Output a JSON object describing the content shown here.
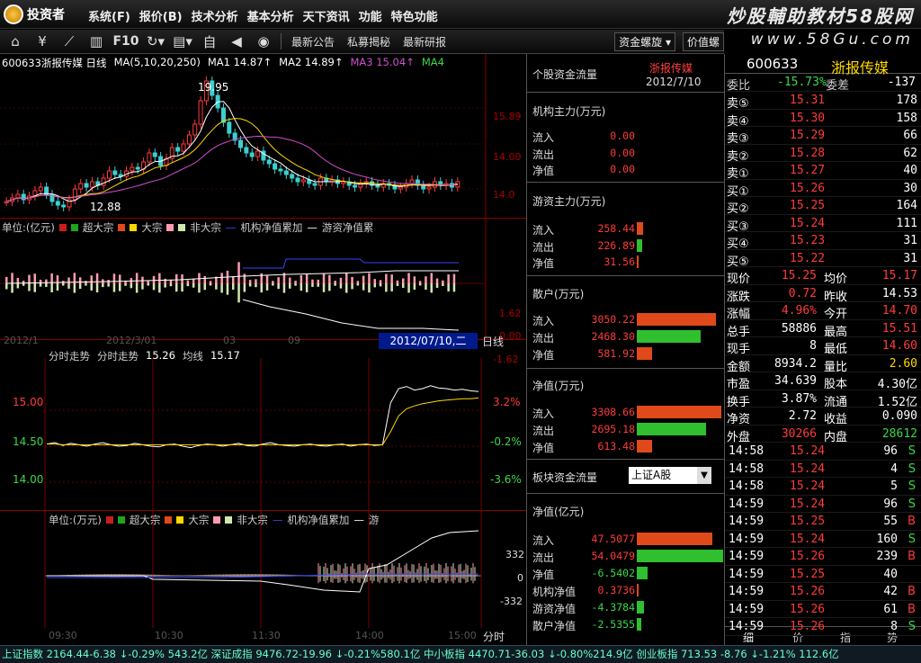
{
  "app": {
    "name": "投资者",
    "menus": [
      "系统(F)",
      "报价(B)",
      "技术分析",
      "基本分析",
      "天下资讯",
      "功能",
      "特色功能"
    ]
  },
  "watermark": {
    "line1": "炒股輔助教材58股网",
    "line2": "www.58Gu.com"
  },
  "toolbar": {
    "f10": "F10",
    "links": [
      "最新公告",
      "私募揭秘",
      "最新研报"
    ],
    "select1": "资金螺旋",
    "select2": "价值螺"
  },
  "kline": {
    "title": "600633浙报传媒  日线",
    "ma_params": "MA(5,10,20,250)",
    "ma1": "MA1 14.87↑",
    "ma2": "MA2 14.89↑",
    "ma3": "MA3 15.04↑",
    "ma4": "MA4",
    "high": "19.95",
    "low": "12.88",
    "yticks": [
      "15.89",
      "14.00",
      "14.0"
    ],
    "closes": [
      13.2,
      13.4,
      13.6,
      13.3,
      13.5,
      13.8,
      14.0,
      13.6,
      13.2,
      13.0,
      12.9,
      13.3,
      13.9,
      14.2,
      14.0,
      14.3,
      14.1,
      14.5,
      14.9,
      14.7,
      14.6,
      14.9,
      15.1,
      15.0,
      15.4,
      15.9,
      15.7,
      15.2,
      15.6,
      16.2,
      16.0,
      16.4,
      16.9,
      17.5,
      18.8,
      19.9,
      19.1,
      18.4,
      17.6,
      17.0,
      16.6,
      16.2,
      15.9,
      15.7,
      16.0,
      15.5,
      15.3,
      15.0,
      14.9,
      14.7,
      14.5,
      14.3,
      14.4,
      14.2,
      14.1,
      14.5,
      14.3,
      14.4,
      14.2,
      14.3,
      14.1,
      14.0,
      14.2,
      14.3,
      14.1,
      14.0,
      14.2,
      14.1,
      13.9,
      14.0,
      14.2,
      14.4,
      14.1,
      13.9,
      14.0,
      14.3,
      14.1,
      14.2,
      14.0,
      14.3
    ],
    "yrange": [
      12.5,
      20.5
    ]
  },
  "fund_legend": {
    "unit": "单位:(亿元)",
    "items": [
      "超大宗",
      "大宗",
      "非大宗"
    ],
    "line1": "机构净值累加",
    "line2": "游资净值累"
  },
  "fund_colors": [
    "#c81e1e",
    "#1ea51e",
    "#e04a1a",
    "#ffd600",
    "#ff9bb0",
    "#cfe8b0"
  ],
  "fund_y": [
    "1.62",
    "0.00",
    "-1.62"
  ],
  "dates": {
    "labels": [
      "2012/1",
      "2012/3/01",
      "06",
      "03",
      "09",
      "9"
    ],
    "badge": "2012/07/10,二",
    "period": "日线"
  },
  "fenshi": {
    "title": "分时走势",
    "title2": "分时走势",
    "price": "15.26",
    "avg_label": "均线",
    "avg": "15.17",
    "yleft": [
      "15.00",
      "14.50",
      "14.00"
    ],
    "yright": [
      "3.2%",
      "-0.2%",
      "-3.6%"
    ],
    "times": [
      "09:30",
      "10:30",
      "11:30",
      "14:00",
      "15:00"
    ],
    "axis_end": "分时",
    "prices": [
      14.53,
      14.55,
      14.51,
      14.54,
      14.52,
      14.5,
      14.53,
      14.55,
      14.52,
      14.5,
      14.51,
      14.54,
      14.52,
      14.5,
      14.49,
      14.52,
      14.53,
      14.5,
      14.48,
      14.51,
      14.53,
      14.52,
      14.5,
      14.52,
      14.54,
      14.51,
      14.5,
      14.53,
      14.55,
      14.52,
      14.51,
      14.5,
      14.52,
      14.53,
      14.51,
      14.5,
      14.52,
      14.53,
      14.5,
      14.52,
      14.53,
      14.51,
      14.52,
      15.1,
      15.3,
      15.33,
      15.28,
      15.3,
      15.34,
      15.31,
      15.3,
      15.28,
      15.29,
      15.27,
      15.26
    ],
    "avgs": [
      14.53,
      14.53,
      14.52,
      14.52,
      14.52,
      14.52,
      14.52,
      14.52,
      14.52,
      14.52,
      14.52,
      14.52,
      14.52,
      14.52,
      14.52,
      14.52,
      14.52,
      14.52,
      14.52,
      14.52,
      14.52,
      14.52,
      14.52,
      14.52,
      14.52,
      14.52,
      14.52,
      14.52,
      14.52,
      14.52,
      14.52,
      14.52,
      14.52,
      14.52,
      14.52,
      14.52,
      14.52,
      14.52,
      14.52,
      14.52,
      14.52,
      14.52,
      14.52,
      14.7,
      14.92,
      15.02,
      15.06,
      15.09,
      15.11,
      15.13,
      15.14,
      15.15,
      15.16,
      15.16,
      15.17
    ]
  },
  "fs2": {
    "unit": "单位:(万元)",
    "items": [
      "超大宗",
      "大宗",
      "非大宗"
    ],
    "line1": "机构净值累加",
    "line2": "游",
    "y": [
      "332",
      "0",
      "-332"
    ]
  },
  "mid": {
    "title": "个股资金流量",
    "stock": "浙报传媒",
    "date": "2012/7/10",
    "sections": [
      {
        "title": "机构主力(万元)",
        "rows": [
          [
            "流入",
            "0.00"
          ],
          [
            "流出",
            "0.00"
          ],
          [
            "净值",
            "0.00"
          ]
        ]
      },
      {
        "title": "游资主力(万元)",
        "rows": [
          [
            "流入",
            "258.44"
          ],
          [
            "流出",
            "226.89"
          ],
          [
            "净值",
            "31.56"
          ]
        ]
      },
      {
        "title": "散户(万元)",
        "rows": [
          [
            "流入",
            "3050.22"
          ],
          [
            "流出",
            "2468.30"
          ],
          [
            "净值",
            "581.92"
          ]
        ]
      },
      {
        "title": "净值(万元)",
        "rows": [
          [
            "流入",
            "3308.66"
          ],
          [
            "流出",
            "2695.18"
          ],
          [
            "净值",
            "613.48"
          ]
        ]
      }
    ],
    "block_title": "板块资金流量",
    "block_select": "上证A股",
    "net_title": "净值(亿元)",
    "net_rows": [
      [
        "流入",
        "47.5077"
      ],
      [
        "流出",
        "54.0479"
      ],
      [
        "净值",
        "-6.5402"
      ],
      [
        "机构净值",
        "0.3736"
      ],
      [
        "游资净值",
        "-4.3784"
      ],
      [
        "散户净值",
        "-2.5355"
      ]
    ]
  },
  "right": {
    "code": "600633",
    "name": "浙报传媒",
    "weibi_label": "委比",
    "weibi": "-15.73%",
    "weicha_label": "委差",
    "weicha": "-137",
    "sells": [
      [
        "卖⑤",
        "15.31",
        "178"
      ],
      [
        "卖④",
        "15.30",
        "158"
      ],
      [
        "卖③",
        "15.29",
        "66"
      ],
      [
        "卖②",
        "15.28",
        "62"
      ],
      [
        "卖①",
        "15.27",
        "40"
      ]
    ],
    "buys": [
      [
        "买①",
        "15.26",
        "30"
      ],
      [
        "买②",
        "15.25",
        "164"
      ],
      [
        "买③",
        "15.24",
        "111"
      ],
      [
        "买④",
        "15.23",
        "31"
      ],
      [
        "买⑤",
        "15.22",
        "31"
      ]
    ],
    "stats": [
      [
        "现价",
        "15.25",
        "均价",
        "15.17"
      ],
      [
        "涨跌",
        "0.72",
        "昨收",
        "14.53"
      ],
      [
        "涨幅",
        "4.96%",
        "今开",
        "14.70"
      ],
      [
        "总手",
        "58886",
        "最高",
        "15.51"
      ],
      [
        "现手",
        "8",
        "最低",
        "14.60"
      ],
      [
        "金额",
        "8934.2",
        "量比",
        "2.60"
      ],
      [
        "市盈",
        "34.639",
        "股本",
        "4.30亿"
      ],
      [
        "换手",
        "3.87%",
        "流通",
        "1.52亿"
      ],
      [
        "净资",
        "2.72",
        "收益",
        "0.090"
      ],
      [
        "外盘",
        "30266",
        "内盘",
        "28612"
      ]
    ],
    "ticks": [
      [
        "14:58",
        "15.24",
        "96",
        "S"
      ],
      [
        "14:58",
        "15.24",
        "4",
        "S"
      ],
      [
        "14:58",
        "15.24",
        "5",
        "S"
      ],
      [
        "14:59",
        "15.24",
        "96",
        "S"
      ],
      [
        "14:59",
        "15.25",
        "55",
        "B"
      ],
      [
        "14:59",
        "15.24",
        "160",
        "S"
      ],
      [
        "14:59",
        "15.26",
        "239",
        "B"
      ],
      [
        "14:59",
        "15.25",
        "40",
        ""
      ],
      [
        "14:59",
        "15.26",
        "42",
        "B"
      ],
      [
        "14:59",
        "15.26",
        "61",
        "B"
      ],
      [
        "14:59",
        "15.26",
        "8",
        "S"
      ]
    ],
    "tabs": [
      "细",
      "价",
      "指",
      "势"
    ]
  },
  "status": "上证指数 2164.44-6.38 ↓-0.29% 543.2亿 深证成指 9476.72-19.96 ↓-0.21%580.1亿 中小板指 4470.71-36.03 ↓-0.80%214.9亿 创业板指 713.53 -8.76 ↓-1.21% 112.6亿"
}
